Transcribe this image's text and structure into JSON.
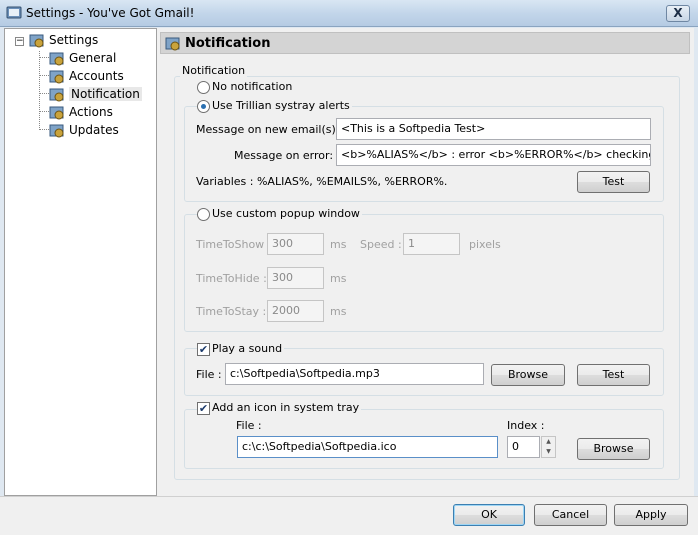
{
  "window": {
    "title": "Settings - You've Got Gmail!",
    "close_glyph": "X"
  },
  "tree": {
    "root": "Settings",
    "items": [
      "General",
      "Accounts",
      "Notification",
      "Actions",
      "Updates"
    ],
    "expander": "−"
  },
  "header": {
    "title": "Notification"
  },
  "notification_group": {
    "legend": "Notification"
  },
  "no_notification": {
    "label": "No notification"
  },
  "trillian": {
    "label": "Use Trillian systray alerts",
    "msg_new_label": "Message on new email(s) :",
    "msg_new_value": "<This is a Softpedia Test>",
    "msg_error_label": "Message on error:",
    "msg_error_value": "<b>%ALIAS%</b> : error <b>%ERROR%</b> checking ema",
    "variables": "Variables : %ALIAS%, %EMAILS%, %ERROR%.",
    "test_button": "Test"
  },
  "popup": {
    "label": "Use custom popup window",
    "time_to_show_label": "TimeToShow :",
    "time_to_show_value": "300",
    "ms": "ms",
    "speed_label": "Speed :",
    "speed_value": "1",
    "pixels": "pixels",
    "time_to_hide_label": "TimeToHide :",
    "time_to_hide_value": "300",
    "time_to_stay_label": "TimeToStay :",
    "time_to_stay_value": "2000"
  },
  "sound": {
    "label": "Play a sound",
    "checked": "✔",
    "file_label": "File :",
    "file_value": "c:\\Softpedia\\Softpedia.mp3",
    "browse_button": "Browse",
    "test_button": "Test"
  },
  "tray": {
    "label": "Add an icon in system tray",
    "checked": "✔",
    "file_label": "File :",
    "file_value": "c:\\c:\\Softpedia\\Softpedia.ico",
    "index_label": "Index :",
    "index_value": "0",
    "browse_button": "Browse"
  },
  "footer": {
    "ok": "OK",
    "cancel": "Cancel",
    "apply": "Apply"
  }
}
